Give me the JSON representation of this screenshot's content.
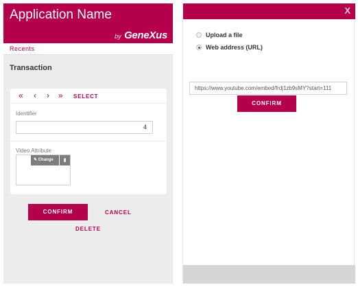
{
  "app": {
    "title": "Application Name",
    "brand_by": "by",
    "brand_name": "GeneXus",
    "recents_label": "Recents",
    "page_title": "Transaction"
  },
  "form": {
    "nav": {
      "first_icon": "«",
      "prev_icon": "‹",
      "next_icon": "›",
      "last_icon": "»",
      "select_label": "SELECT"
    },
    "identifier_label": "Identifier",
    "identifier_value": "4",
    "video_label": "Video Attribute",
    "change_icon": "✎",
    "change_label": "Change",
    "trash_icon": "▮"
  },
  "actions": {
    "confirm_label": "CONFIRM",
    "cancel_label": "CANCEL",
    "delete_label": "DELETE"
  },
  "dialog": {
    "close_label": "X",
    "options": [
      {
        "label": "Upload a file",
        "selected": false
      },
      {
        "label": "Web address (URL)",
        "selected": true
      }
    ],
    "url_value": "https://www.youtube.com/embed/frdj1zb9sMY?start=111",
    "confirm_label": "CONFIRM"
  },
  "colors": {
    "brand": "#b5004b",
    "panel_bg": "#ececec",
    "footer_bg": "#d6d6d6"
  }
}
